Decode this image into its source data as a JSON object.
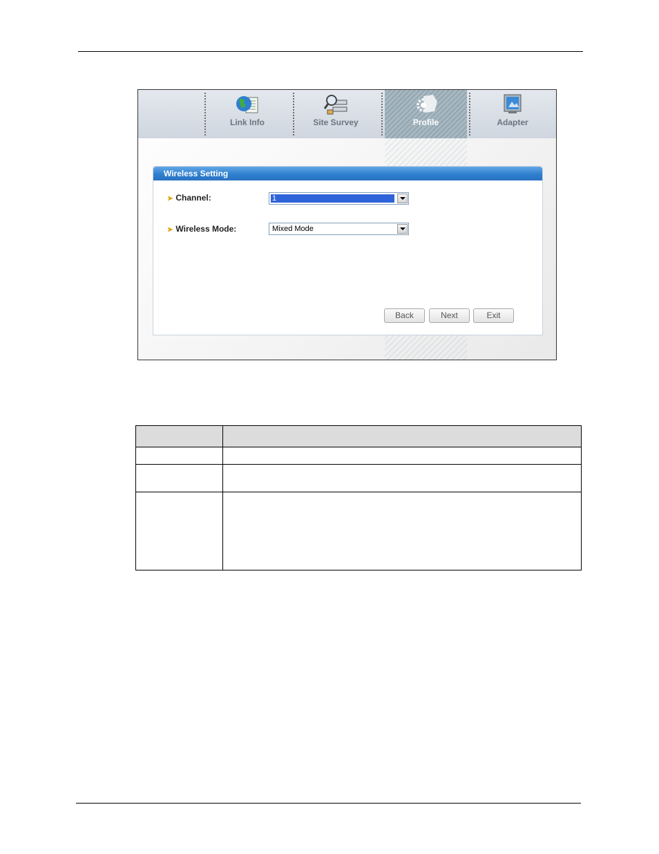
{
  "app": {
    "tabs": [
      {
        "label": "Link Info",
        "icon": "globe-document-icon"
      },
      {
        "label": "Site Survey",
        "icon": "network-search-icon"
      },
      {
        "label": "Profile",
        "icon": "gear-profile-icon"
      },
      {
        "label": "Adapter",
        "icon": "monitor-adapter-icon"
      }
    ],
    "active_tab": "Profile",
    "panel": {
      "title": "Wireless Setting",
      "channel_label": "Channel:",
      "channel_value": "1",
      "mode_label": "Wireless Mode:",
      "mode_value": "Mixed Mode"
    },
    "buttons": {
      "back": "Back",
      "next": "Next",
      "exit": "Exit"
    }
  },
  "colors": {
    "panel_header": "#2f7fcf",
    "active_tab": "#a0b2bc",
    "selection": "#2f63d9"
  }
}
